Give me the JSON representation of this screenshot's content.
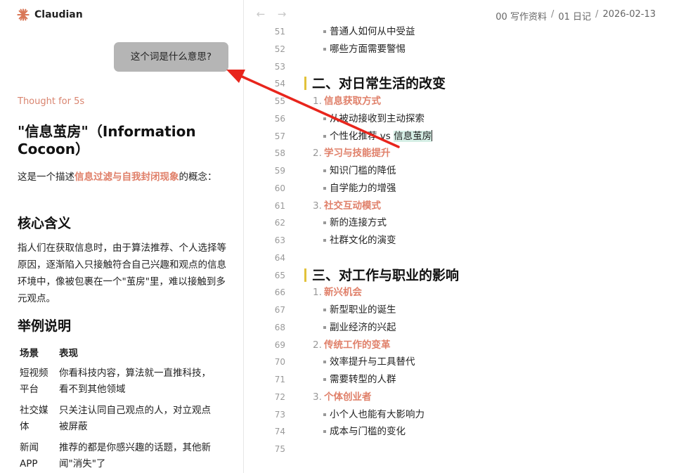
{
  "app": {
    "name": "Claudian"
  },
  "chat": {
    "user_message": "这个词是什么意思?",
    "thought": "Thought for 5s",
    "answer_title": "\"信息茧房\"（Information Cocoon）",
    "intro_before": "这是一个描述",
    "intro_highlight": "信息过滤与自我封闭现象",
    "intro_after": "的概念：",
    "core_heading": "核心含义",
    "core_text": "指人们在获取信息时，由于算法推荐、个人选择等原因，逐渐陷入只接触符合自己兴趣和观点的信息环境中，像被包裹在一个\"茧房\"里，难以接触到多元观点。",
    "example_heading": "举例说明",
    "table": {
      "headers": [
        "场景",
        "表现"
      ],
      "rows": [
        [
          "短视频平台",
          "你看科技内容，算法就一直推科技，看不到其他领域"
        ],
        [
          "社交媒体",
          "只关注认同自己观点的人，对立观点被屏蔽"
        ],
        [
          "新闻APP",
          "推荐的都是你感兴趣的话题，其他新闻\"消失\"了"
        ]
      ]
    }
  },
  "editor": {
    "breadcrumb": [
      "00 写作资料",
      "01 日记",
      "2026-02-13"
    ],
    "lines": [
      {
        "n": "51",
        "type": "bullet",
        "text": "普通人如何从中受益"
      },
      {
        "n": "52",
        "type": "bullet",
        "text": "哪些方面需要警惕"
      },
      {
        "n": "53",
        "type": "empty"
      },
      {
        "n": "54",
        "type": "heading",
        "text": "二、对日常生活的改变"
      },
      {
        "n": "55",
        "type": "ordered",
        "num": "1.",
        "text": "信息获取方式"
      },
      {
        "n": "56",
        "type": "bullet",
        "text": "从被动接收到主动探索"
      },
      {
        "n": "57",
        "type": "bullet-sel",
        "text": "个性化推荐 vs ",
        "selected": "信息茧房"
      },
      {
        "n": "58",
        "type": "ordered",
        "num": "2.",
        "text": "学习与技能提升"
      },
      {
        "n": "59",
        "type": "bullet",
        "text": "知识门槛的降低"
      },
      {
        "n": "60",
        "type": "bullet",
        "text": "自学能力的增强"
      },
      {
        "n": "61",
        "type": "ordered",
        "num": "3.",
        "text": "社交互动模式"
      },
      {
        "n": "62",
        "type": "bullet",
        "text": "新的连接方式"
      },
      {
        "n": "63",
        "type": "bullet",
        "text": "社群文化的演变"
      },
      {
        "n": "64",
        "type": "empty"
      },
      {
        "n": "65",
        "type": "heading",
        "text": "三、对工作与职业的影响"
      },
      {
        "n": "66",
        "type": "ordered",
        "num": "1.",
        "text": "新兴机会"
      },
      {
        "n": "67",
        "type": "bullet",
        "text": "新型职业的诞生"
      },
      {
        "n": "68",
        "type": "bullet",
        "text": "副业经济的兴起"
      },
      {
        "n": "69",
        "type": "ordered",
        "num": "2.",
        "text": "传统工作的变革"
      },
      {
        "n": "70",
        "type": "bullet",
        "text": "效率提升与工具替代"
      },
      {
        "n": "71",
        "type": "bullet",
        "text": "需要转型的人群"
      },
      {
        "n": "72",
        "type": "ordered",
        "num": "3.",
        "text": "个体创业者"
      },
      {
        "n": "73",
        "type": "bullet",
        "text": "小个人也能有大影响力"
      },
      {
        "n": "74",
        "type": "bullet",
        "text": "成本与门槛的变化"
      },
      {
        "n": "75",
        "type": "empty"
      }
    ]
  },
  "colors": {
    "accent": "#e0806a",
    "heading_bar": "#e2c23a",
    "selection": "#d6efe6",
    "arrow": "#e8251c",
    "bubble": "#b5b5b5"
  }
}
